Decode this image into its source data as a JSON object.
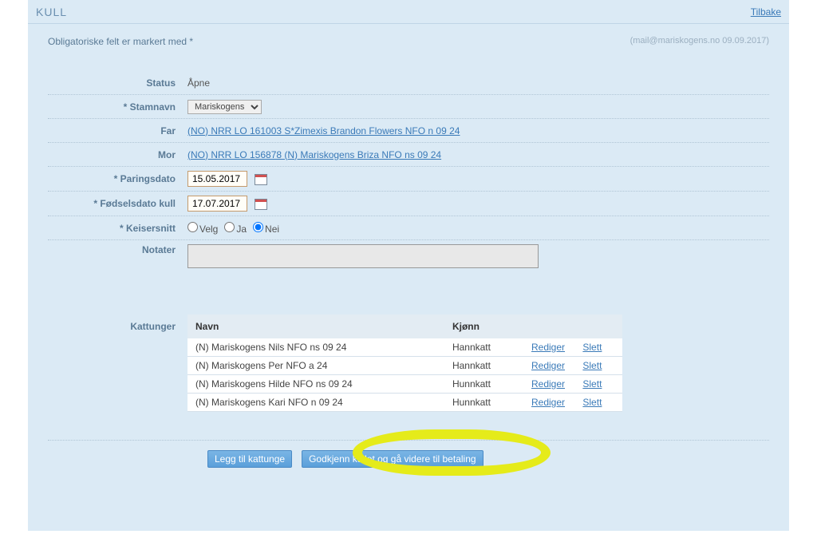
{
  "header": {
    "title": "KULL",
    "back": "Tilbake"
  },
  "meta": {
    "required": "Obligatoriske felt er markert med *",
    "audit": "(mail@mariskogens.no 09.09.2017)"
  },
  "labels": {
    "status": "Status",
    "stamnavn": "* Stamnavn",
    "far": "Far",
    "mor": "Mor",
    "paring": "* Paringsdato",
    "fodsel": "* Fødselsdato kull",
    "keiser": "* Keisersnitt",
    "notater": "Notater",
    "kattunger": "Kattunger"
  },
  "values": {
    "status": "Åpne",
    "stamnavn": "Mariskogens",
    "far": "(NO) NRR LO 161003 S*Zimexis Brandon Flowers NFO n 09 24",
    "mor": "(NO) NRR LO 156878 (N) Mariskogens Briza NFO ns 09 24",
    "paring": "15.05.2017",
    "fodsel": "17.07.2017"
  },
  "keiser": {
    "velg": "Velg",
    "ja": "Ja",
    "nei": "Nei",
    "selected": "nei"
  },
  "table": {
    "headers": {
      "name": "Navn",
      "sex": "Kjønn"
    },
    "actions": {
      "edit": "Rediger",
      "del": "Slett"
    },
    "rows": [
      {
        "name": "(N) Mariskogens Nils NFO ns 09 24",
        "sex": "Hannkatt"
      },
      {
        "name": "(N) Mariskogens Per NFO a 24",
        "sex": "Hannkatt"
      },
      {
        "name": "(N) Mariskogens Hilde NFO ns 09 24",
        "sex": "Hunnkatt"
      },
      {
        "name": "(N) Mariskogens Kari NFO n 09 24",
        "sex": "Hunnkatt"
      }
    ]
  },
  "buttons": {
    "add": "Legg til kattunge",
    "approve": "Godkjenn kullet og gå videre til betaling"
  }
}
